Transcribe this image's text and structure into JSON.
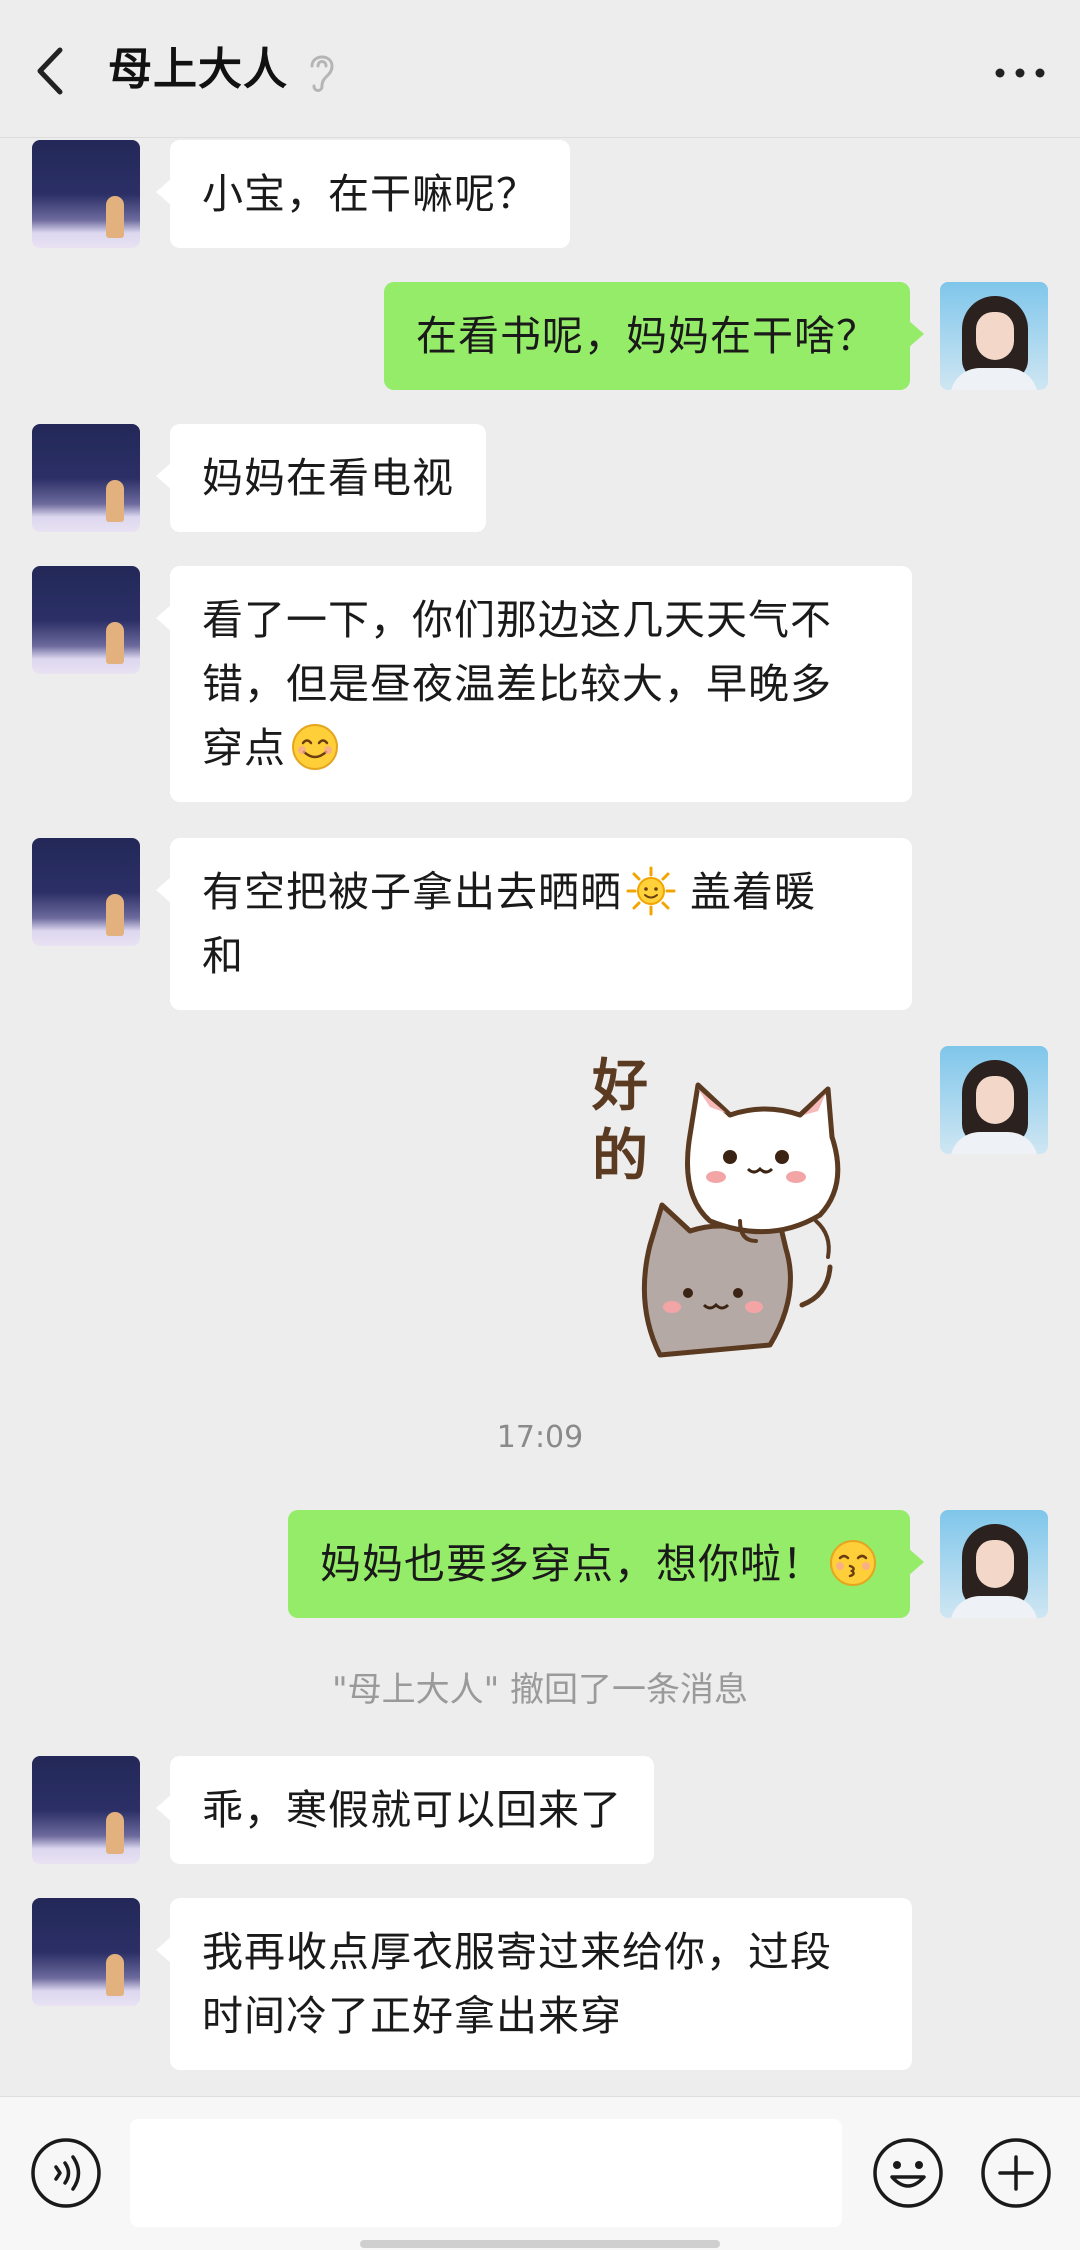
{
  "header": {
    "title": "母上大人"
  },
  "messages": {
    "m1": "小宝，在干嘛呢？",
    "m2": "在看书呢，妈妈在干啥？",
    "m3": "妈妈在看电视",
    "m4_line1": "看了一下，你们那边这几天天气不",
    "m4_line2": "错，但是昼夜温差比较大，早晚多",
    "m4_line3": "穿点",
    "m5_line1": "有空把被子拿出去晒晒",
    "m5_line1b": " 盖着暖",
    "m5_line2": "和",
    "sticker_text1": "好",
    "sticker_text2": "的",
    "time": "17:09",
    "m6": "妈妈也要多穿点，想你啦！",
    "recall": "\"母上大人\" 撤回了一条消息",
    "m7": "乖，寒假就可以回来了",
    "m8_line1": "我再收点厚衣服寄过来给你，过段",
    "m8_line2": "时间冷了正好拿出来穿"
  },
  "icons": {
    "back": "chevron-left-icon",
    "mute": "ear-mute-icon",
    "more": "more-dots-icon",
    "voice": "voice-icon",
    "emoji": "emoji-icon",
    "plus": "plus-icon"
  },
  "colors": {
    "background": "#ededed",
    "incoming_bubble": "#ffffff",
    "outgoing_bubble": "#95ec69",
    "timestamp_text": "#8a8a8a"
  }
}
